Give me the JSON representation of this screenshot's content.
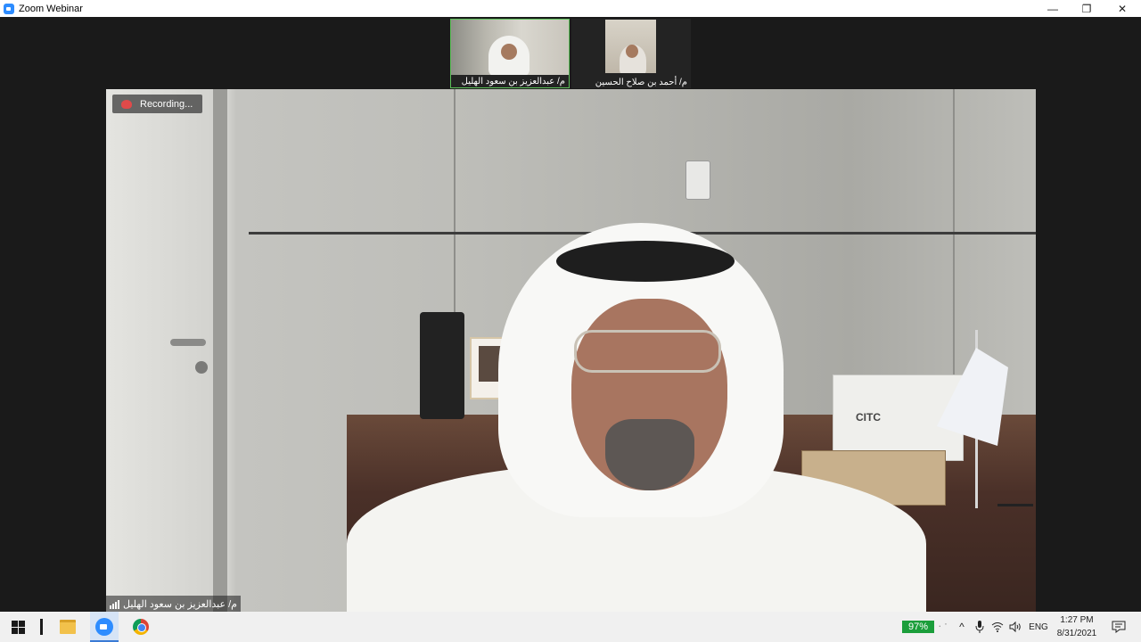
{
  "window": {
    "title": "Zoom Webinar",
    "controls": {
      "minimize": "—",
      "maximize": "❐",
      "close": "✕"
    }
  },
  "participants": [
    {
      "name": "م/ عبدالعزيز بن سعود الهليل",
      "active": true
    },
    {
      "name": "م/ أحمد بن صلاح الحسين",
      "active": false
    }
  ],
  "main_video": {
    "recording_label": "Recording...",
    "speaker_name": "م/ عبدالعزيز بن سعود الهليل",
    "box_logo": "CITC"
  },
  "taskbar": {
    "apps": [
      "windows-start",
      "search",
      "file-explorer",
      "zoom",
      "chrome"
    ],
    "battery": "97%",
    "tray": {
      "chevron": "^",
      "language": "ENG"
    },
    "time": "1:27 PM",
    "date": "8/31/2021"
  },
  "colors": {
    "active_speaker_border": "#5dc25a",
    "zoom_blue": "#2d8cff",
    "battery_green": "#1b9e3b",
    "recording_red": "#e04a4a"
  }
}
